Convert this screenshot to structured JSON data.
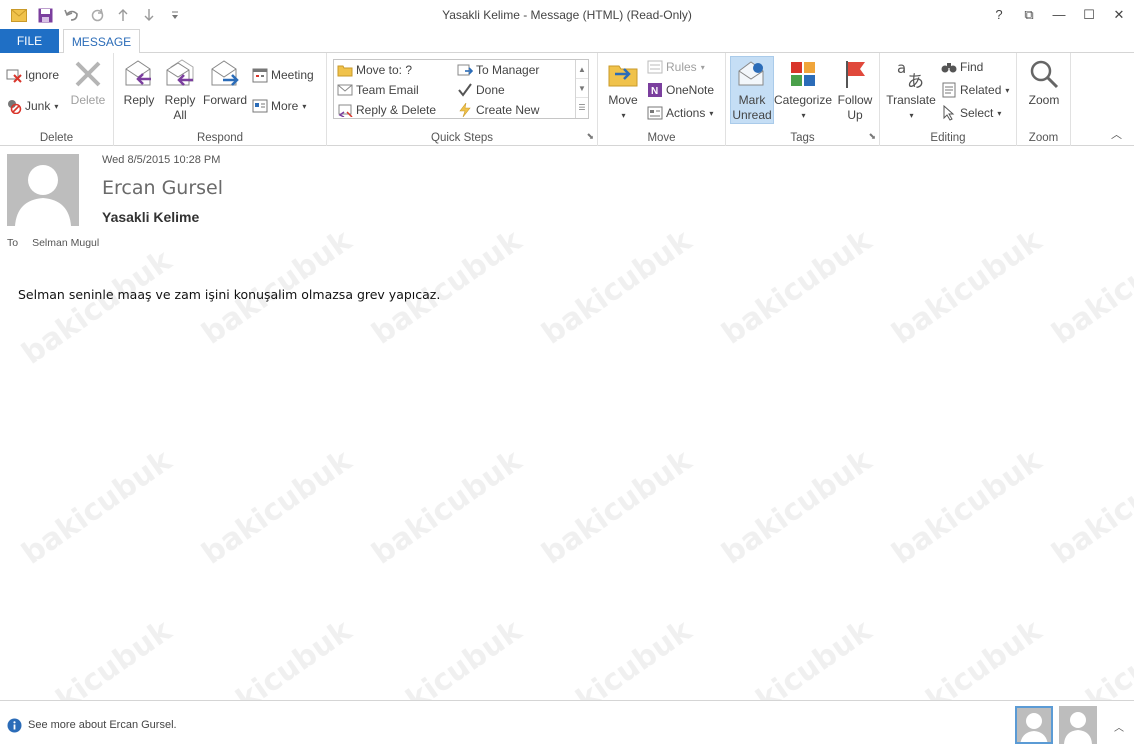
{
  "window": {
    "title": "Yasakli Kelime - Message (HTML) (Read-Only)",
    "controls": [
      "?",
      "⧉",
      "—",
      "☐",
      "✕"
    ]
  },
  "tabs": {
    "file": "FILE",
    "message": "MESSAGE"
  },
  "ribbon": {
    "delete_group": {
      "label": "Delete",
      "ignore": "Ignore",
      "junk": "Junk",
      "delete": "Delete"
    },
    "respond_group": {
      "label": "Respond",
      "reply": "Reply",
      "reply_all_1": "Reply",
      "reply_all_2": "All",
      "forward": "Forward",
      "meeting": "Meeting",
      "more": "More"
    },
    "quicksteps_group": {
      "label": "Quick Steps",
      "move_to": "Move to: ?",
      "team_email": "Team Email",
      "reply_delete": "Reply & Delete",
      "to_manager": "To Manager",
      "done": "Done",
      "create_new": "Create New"
    },
    "move_group": {
      "label": "Move",
      "move": "Move",
      "rules": "Rules",
      "onenote": "OneNote",
      "actions": "Actions"
    },
    "tags_group": {
      "label": "Tags",
      "mark_unread_1": "Mark",
      "mark_unread_2": "Unread",
      "categorize": "Categorize",
      "follow_up_1": "Follow",
      "follow_up_2": "Up"
    },
    "editing_group": {
      "label": "Editing",
      "translate": "Translate",
      "find": "Find",
      "related": "Related",
      "select": "Select"
    },
    "zoom_group": {
      "label": "Zoom",
      "zoom": "Zoom"
    }
  },
  "message": {
    "date": "Wed 8/5/2015 10:28 PM",
    "sender": "Ercan Gursel",
    "subject": "Yasakli Kelime",
    "to_label": "To",
    "to_value": "Selman Mugul",
    "body": "Selman seninle maaş ve zam işini konuşalim olmazsa grev yapıcaz."
  },
  "people_pane": {
    "info": "See more about Ercan Gursel."
  },
  "watermark": "bakicubuk",
  "colors": {
    "file_tab": "#1f6fc5",
    "accent": "#2b6cb8",
    "mark_unread_bg": "#c5def5"
  }
}
